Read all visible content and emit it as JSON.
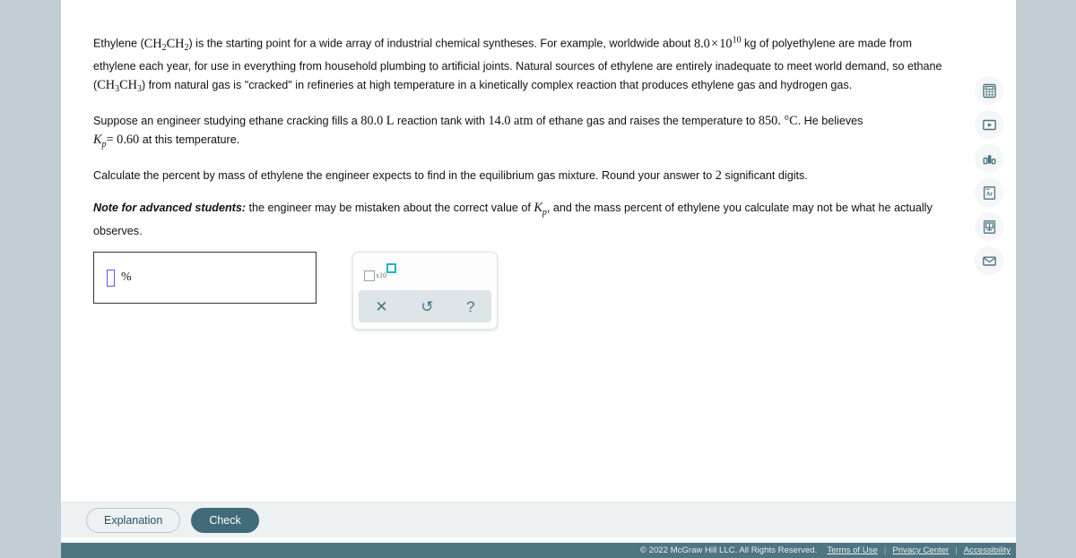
{
  "topbar": {
    "collapse_icon": "chevron-down-icon"
  },
  "question": {
    "paragraph1": {
      "seg1": "Ethylene (",
      "formula_ethylene": "CH2CH2",
      "seg2": ") is the starting point for a wide array of industrial chemical syntheses. For example, worldwide about ",
      "quantity": "8.0 × 10^10",
      "seg3": " kg of polyethylene are made from ethylene each year, for use in everything from household plumbing to artificial joints. Natural sources of ethylene are entirely inadequate to meet world demand, so ethane (",
      "formula_ethane": "CH3CH3",
      "seg4": ") from natural gas is \"cracked\" in refineries at high temperature in a kinetically complex reaction that produces ethylene gas and hydrogen gas."
    },
    "paragraph2": {
      "seg1": "Suppose an engineer studying ethane cracking fills a ",
      "volume": "80.0",
      "volume_unit": "L",
      "seg2": " reaction tank with ",
      "pressure": "14.0",
      "pressure_unit": "atm",
      "seg3": " of ethane gas and raises the temperature to ",
      "temperature": "850.",
      "temperature_unit": "°C",
      "seg4": ". He believes ",
      "kp_symbol": "Kp",
      "kp_eq": "= 0.60",
      "seg5": " at this temperature."
    },
    "paragraph3": {
      "seg1": "Calculate the percent by mass of ethylene the engineer expects to find in the equilibrium gas mixture. Round your answer to ",
      "sigfigs": "2",
      "seg2": " significant digits."
    },
    "note": {
      "lead": "Note for advanced students:",
      "seg1": " the engineer may be mistaken about the correct value of ",
      "kp_symbol": "Kp",
      "seg2": ", and the mass percent of ethylene you calculate may not be what he actually observes."
    }
  },
  "answer": {
    "value": "",
    "unit_label": "%",
    "cursor_icon": "text-cursor-placeholder-icon"
  },
  "palette": {
    "sci_notation": {
      "icon": "scientific-notation-icon",
      "multiplier_label": "x10"
    },
    "buttons": [
      {
        "name": "clear-button",
        "glyph": "✕"
      },
      {
        "name": "undo-button",
        "glyph": "↺"
      },
      {
        "name": "help-button",
        "glyph": "?"
      }
    ]
  },
  "rail": {
    "items": [
      {
        "name": "calculator-icon",
        "label": "Calculator"
      },
      {
        "name": "video-play-icon",
        "label": "Video"
      },
      {
        "name": "bar-chart-icon",
        "label": "Data"
      },
      {
        "name": "periodic-table-icon",
        "label": "Ar"
      },
      {
        "name": "reference-book-icon",
        "label": "Reference"
      },
      {
        "name": "envelope-icon",
        "label": "Message"
      }
    ]
  },
  "actions": {
    "explanation_label": "Explanation",
    "check_label": "Check"
  },
  "footer": {
    "copyright": "© 2022 McGraw Hill LLC. All Rights Reserved.",
    "links": [
      "Terms of Use",
      "Privacy Center",
      "Accessibility"
    ],
    "separator": "|"
  },
  "colors": {
    "page_background": "#c2ced4",
    "footer_bar": "#4e7582",
    "accent_teal": "#27b0c6",
    "check_button": "#416b78",
    "cursor_blue": "#5b5bf0"
  }
}
